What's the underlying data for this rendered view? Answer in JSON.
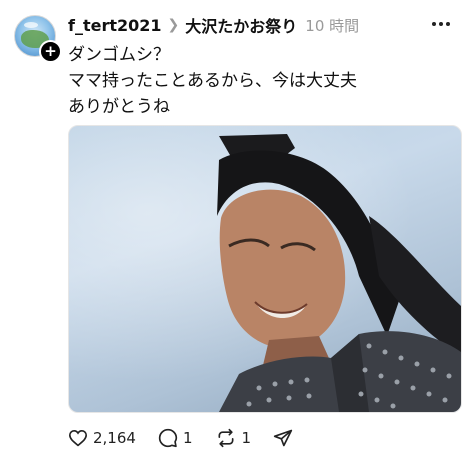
{
  "post": {
    "username": "f_tert2021",
    "community": "大沢たかお祭り",
    "timestamp": "10 時間",
    "text_lines": [
      "ダンゴムシ？",
      "ママ持ったことあるから、今は大丈夫",
      "ありがとうね"
    ]
  },
  "icons": {
    "breadcrumb": "chevron-right-icon",
    "more": "more-options-icon",
    "follow": "plus-icon",
    "like": "heart-icon",
    "reply": "comment-icon",
    "repost": "repost-icon",
    "share": "send-icon"
  },
  "actions": {
    "like_count": "2,164",
    "reply_count": "1",
    "repost_count": "1"
  },
  "colors": {
    "text": "#101010",
    "muted": "#9a9a9a",
    "background": "#ffffff"
  }
}
